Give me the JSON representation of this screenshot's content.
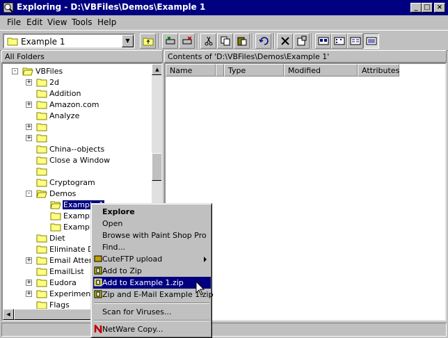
{
  "window": {
    "title": "Exploring - D:\\VBFiles\\Demos\\Example 1"
  },
  "menu": [
    "File",
    "Edit",
    "View",
    "Tools",
    "Help"
  ],
  "toolbar": {
    "location_value": "Example 1"
  },
  "left_pane": {
    "header": "All Folders"
  },
  "right_pane": {
    "header": "Contents of 'D:\\VBFiles\\Demos\\Example 1'",
    "columns": [
      "Name",
      "Type",
      "Modified",
      "Attributes"
    ]
  },
  "tree": [
    {
      "label": "VBFiles",
      "expanded": true
    },
    {
      "label": "2d"
    },
    {
      "label": "Addition"
    },
    {
      "label": "Amazon.com"
    },
    {
      "label": "Analyze"
    },
    {
      "label": ""
    },
    {
      "label": ""
    },
    {
      "label": "China--objects"
    },
    {
      "label": "Close a Window"
    },
    {
      "label": ""
    },
    {
      "label": "Cryptogram"
    },
    {
      "label": "Demos",
      "expanded": true
    },
    {
      "label": "Example 1",
      "selected": true
    },
    {
      "label": "Example"
    },
    {
      "label": "Example"
    },
    {
      "label": "Diet"
    },
    {
      "label": "Eliminate Dup"
    },
    {
      "label": "Email Attemp"
    },
    {
      "label": "EmailList"
    },
    {
      "label": "Eudora"
    },
    {
      "label": "Experiments"
    },
    {
      "label": "Flags"
    }
  ],
  "context_menu": [
    {
      "label": "Explore",
      "bold": true
    },
    {
      "label": "Open"
    },
    {
      "label": "Browse with Paint Shop Pro"
    },
    {
      "label": "Find..."
    },
    {
      "label": "CuteFTP upload",
      "submenu": true
    },
    {
      "label": "Add to Zip"
    },
    {
      "label": "Add to Example 1.zip",
      "highlighted": true
    },
    {
      "label": "Zip and E-Mail Example 1.zip"
    },
    {
      "label": "Scan for Viruses..."
    },
    {
      "label": "NetWare Copy..."
    }
  ]
}
